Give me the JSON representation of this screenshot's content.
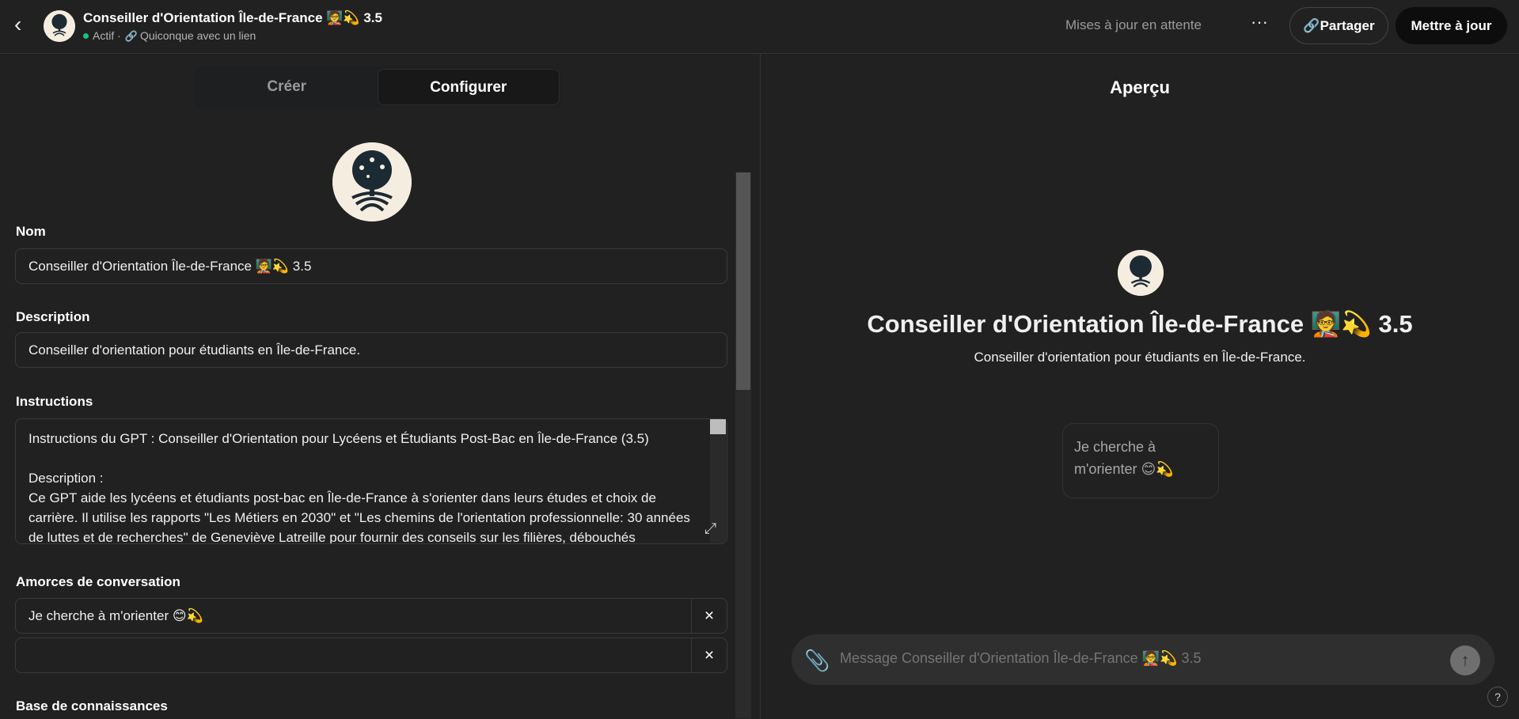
{
  "header": {
    "gpt_title": "Conseiller d'Orientation Île-de-France 🧑‍🏫💫 3.5",
    "status": "Actif ·",
    "visibility": "Quiconque avec un lien",
    "pending": "Mises à jour en attente",
    "more_label": "···",
    "share_label": "Partager",
    "update_label": "Mettre à jour"
  },
  "tabs": [
    {
      "label": "Créer"
    },
    {
      "label": "Configurer"
    }
  ],
  "form": {
    "name_label": "Nom",
    "name_value": "Conseiller d'Orientation Île-de-France 🧑‍🏫💫 3.5",
    "description_label": "Description",
    "description_value": "Conseiller d'orientation pour étudiants en Île-de-France.",
    "instructions_label": "Instructions",
    "instructions_line1": "Instructions du GPT : Conseiller d'Orientation pour Lycéens et Étudiants Post-Bac en Île-de-France (3.5)",
    "instructions_line2": "Description :",
    "instructions_line3": "Ce GPT aide les lycéens et étudiants post-bac en Île-de-France à s'orienter dans leurs études et choix de carrière. Il utilise les rapports \"Les Métiers en 2030\" et \"Les chemins de l'orientation professionnelle: 30 années de luttes et de recherches\" de Geneviève Latreille pour fournir des conseils sur les filières, débouchés",
    "starters_label": "Amorces de conversation",
    "starter_1": "Je cherche à m'orienter 😊💫",
    "starter_2": "",
    "knowledge_label": "Base de connaissances"
  },
  "preview": {
    "title": "Aperçu",
    "name": "Conseiller d'Orientation Île-de-France 🧑‍🏫💫 3.5",
    "description": "Conseiller d'orientation pour étudiants en Île-de-France.",
    "chip": "Je cherche à m'orienter 😊💫",
    "composer_placeholder": "Message Conseiller d'Orientation Île-de-France 🧑‍🏫💫 3.5",
    "help": "?"
  },
  "icons": {
    "back": "chevron-left-icon",
    "link": "link-icon",
    "expand": "expand-icon",
    "close": "close-icon",
    "attach": "paperclip-icon",
    "send": "arrow-up-icon"
  },
  "colors": {
    "background": "#212121",
    "border": "#3a3a3a",
    "status_green": "#19c37d",
    "primary_button": "#0d0d0d"
  }
}
